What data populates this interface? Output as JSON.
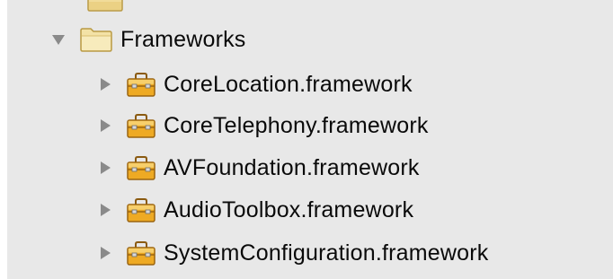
{
  "navigator": {
    "group": {
      "label": "Frameworks",
      "expanded": true,
      "icon": "folder-icon",
      "items": [
        {
          "label": "CoreLocation.framework",
          "expanded": false,
          "icon": "framework-toolbox-icon"
        },
        {
          "label": "CoreTelephony.framework",
          "expanded": false,
          "icon": "framework-toolbox-icon"
        },
        {
          "label": "AVFoundation.framework",
          "expanded": false,
          "icon": "framework-toolbox-icon"
        },
        {
          "label": "AudioToolbox.framework",
          "expanded": false,
          "icon": "framework-toolbox-icon"
        },
        {
          "label": "SystemConfiguration.framework",
          "expanded": false,
          "icon": "framework-toolbox-icon"
        }
      ]
    },
    "colors": {
      "pane_background": "#e8e8e8",
      "disclosure_triangle": "#8a8a8a",
      "folder": "#f3e2a6",
      "toolbox": "#e9a21c"
    }
  }
}
